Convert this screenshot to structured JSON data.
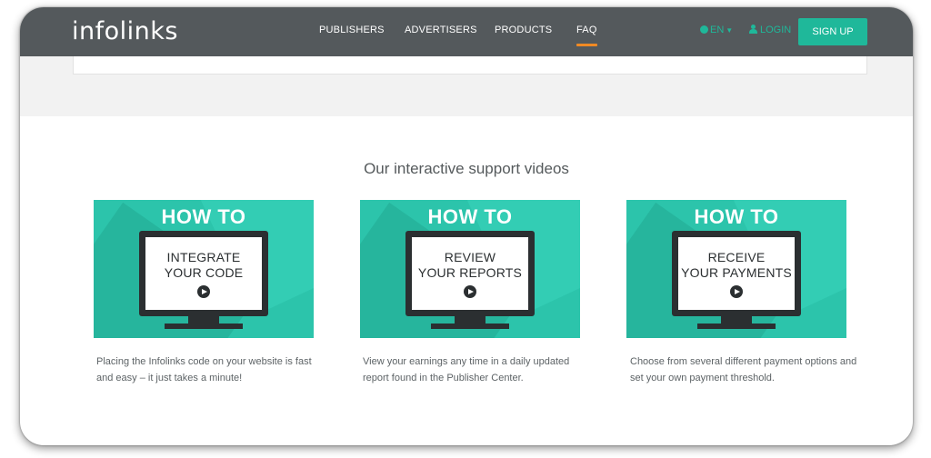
{
  "header": {
    "logo": "infolinks",
    "nav": [
      {
        "label": "PUBLISHERS",
        "active": false
      },
      {
        "label": "ADVERTISERS",
        "active": false
      },
      {
        "label": "PRODUCTS",
        "active": false
      },
      {
        "label": "FAQ",
        "active": true
      }
    ],
    "lang": "EN",
    "login": "LOGIN",
    "signup": "SIGN UP"
  },
  "section": {
    "title": "Our interactive support videos"
  },
  "videos": [
    {
      "howto": "HOW TO",
      "line1": "INTEGRATE",
      "line2": "YOUR CODE",
      "description": "Placing the Infolinks code on your website is fast and easy – it just takes a minute!"
    },
    {
      "howto": "HOW TO",
      "line1": "REVIEW",
      "line2": "YOUR REPORTS",
      "description": "View your earnings any time in a daily updated report found in the Publisher Center."
    },
    {
      "howto": "HOW TO",
      "line1": "RECEIVE",
      "line2": "YOUR PAYMENTS",
      "description": "Choose from several different payment options and set your own payment threshold."
    }
  ],
  "colors": {
    "navbar": "#54595c",
    "accent": "#1fb89a",
    "active_underline": "#f08a24",
    "thumbnail": "#2cc4ab"
  }
}
